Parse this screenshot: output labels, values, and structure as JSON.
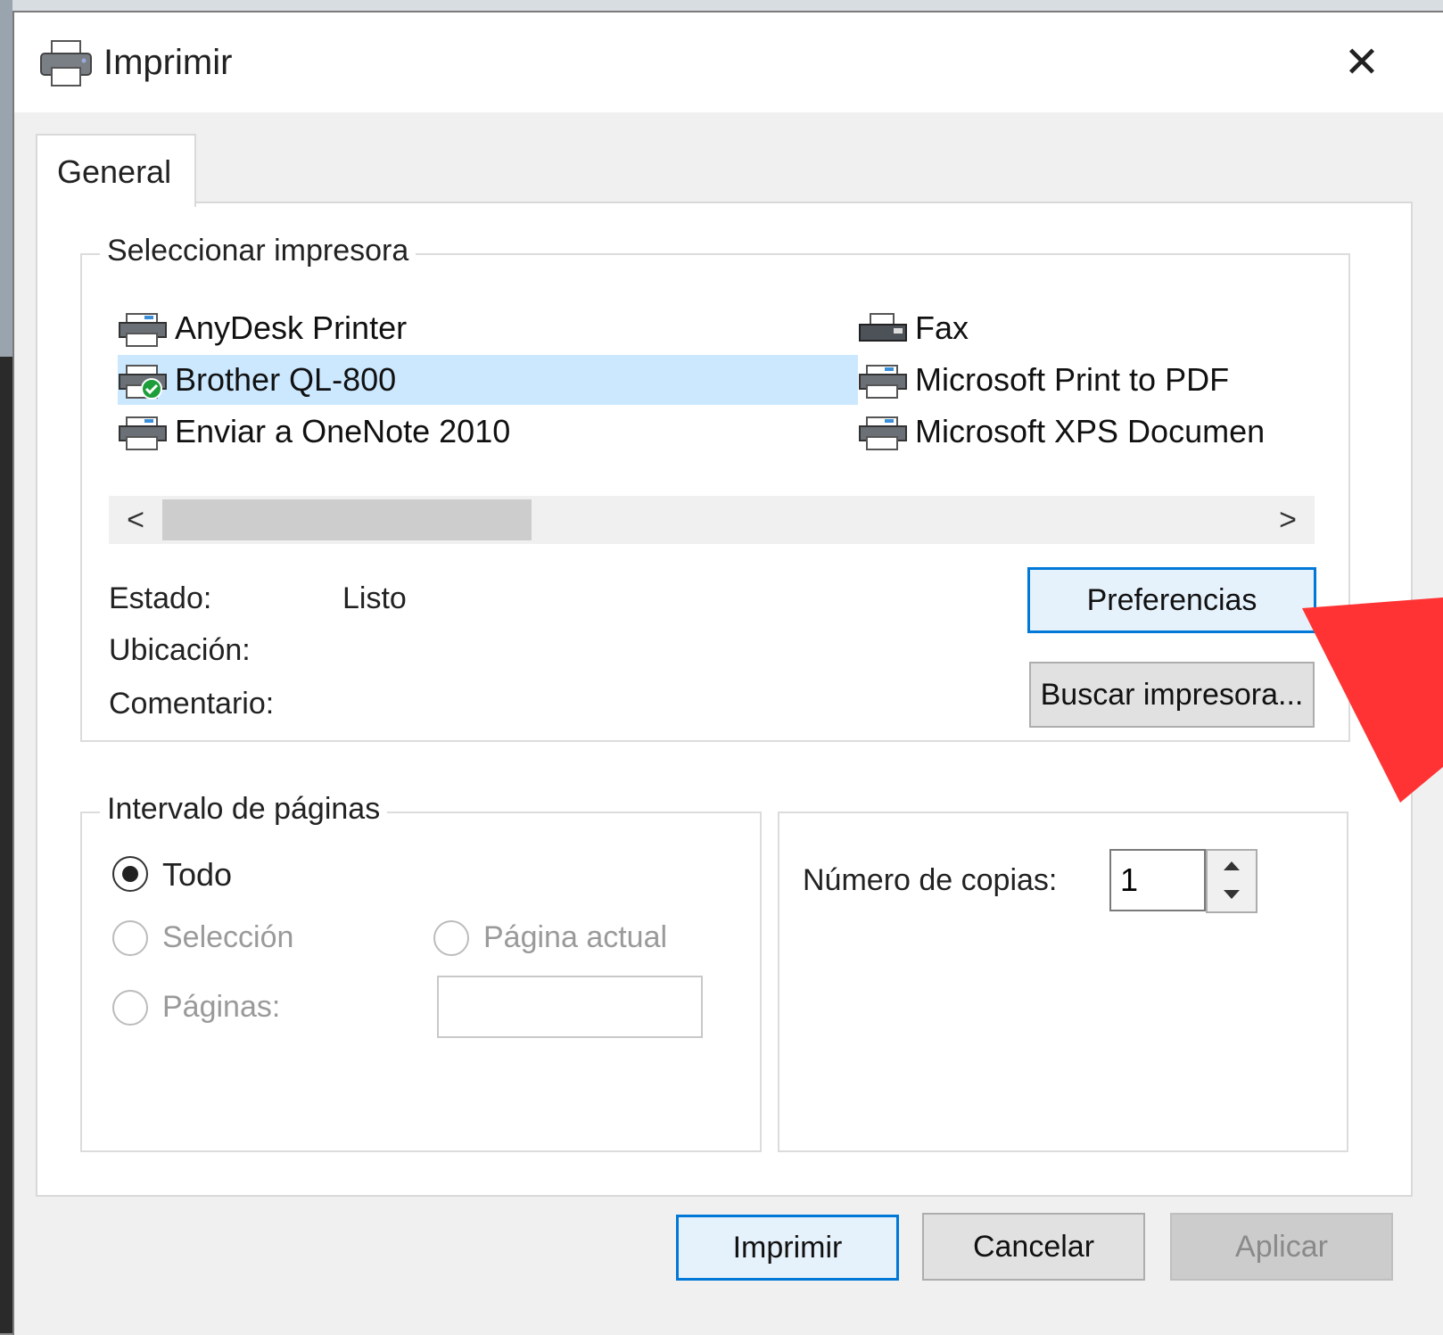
{
  "window": {
    "title": "Imprimir",
    "close_glyph": "✕"
  },
  "tabs": [
    {
      "label": "General"
    }
  ],
  "select_printer": {
    "legend": "Seleccionar impresora",
    "printers": [
      {
        "name": "AnyDesk Printer",
        "icon": "printer-icon"
      },
      {
        "name": "Brother QL-800",
        "icon": "default-printer-icon",
        "selected": true
      },
      {
        "name": "Enviar a OneNote 2010",
        "icon": "printer-icon"
      },
      {
        "name": "Fax",
        "icon": "fax-icon"
      },
      {
        "name": "Microsoft Print to PDF",
        "icon": "printer-icon"
      },
      {
        "name": "Microsoft XPS Documen",
        "icon": "printer-icon"
      }
    ],
    "scroll_left": "<",
    "scroll_right": ">",
    "status_label": "Estado:",
    "status_value": "Listo",
    "location_label": "Ubicación:",
    "comment_label": "Comentario:",
    "preferences_button": "Preferencias",
    "find_printer_button": "Buscar impresora..."
  },
  "page_range": {
    "legend": "Intervalo de páginas",
    "all_label": "Todo",
    "selection_label": "Selección",
    "current_page_label": "Página actual",
    "pages_label": "Páginas:",
    "pages_value": ""
  },
  "copies": {
    "label": "Número de copias:",
    "value": "1"
  },
  "buttons": {
    "print": "Imprimir",
    "cancel": "Cancelar",
    "apply": "Aplicar"
  },
  "colors": {
    "selection": "#cce8ff",
    "focus": "#0078d7",
    "annotation_arrow": "#ff3333"
  }
}
